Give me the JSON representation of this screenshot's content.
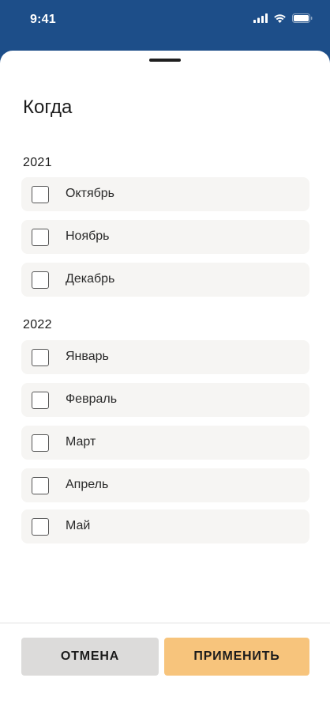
{
  "status_bar": {
    "time": "9:41",
    "icons": [
      "signal-icon",
      "wifi-icon",
      "battery-icon"
    ]
  },
  "colors": {
    "header": "#1d4e89",
    "option_bg": "#f6f5f3",
    "apply_button": "#f7c47c",
    "cancel_button": "#dcdbda"
  },
  "sheet": {
    "title": "Когда",
    "groups": [
      {
        "year": "2021",
        "months": [
          {
            "label": "Октябрь",
            "checked": false
          },
          {
            "label": "Ноябрь",
            "checked": false
          },
          {
            "label": "Декабрь",
            "checked": false
          }
        ]
      },
      {
        "year": "2022",
        "months": [
          {
            "label": "Январь",
            "checked": false
          },
          {
            "label": "Февраль",
            "checked": false
          },
          {
            "label": "Март",
            "checked": false
          },
          {
            "label": "Апрель",
            "checked": false
          },
          {
            "label": "Май",
            "checked": false
          }
        ]
      }
    ]
  },
  "footer": {
    "cancel_label": "ОТМЕНА",
    "apply_label": "ПРИМЕНИТЬ"
  }
}
